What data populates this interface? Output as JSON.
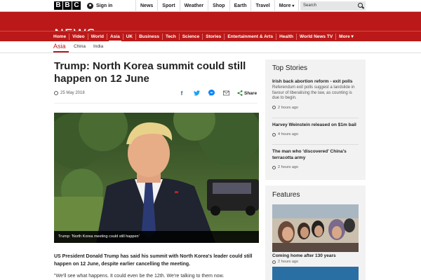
{
  "topbar": {
    "logo_letters": [
      "B",
      "B",
      "C"
    ],
    "signin_label": "Sign in",
    "nav": [
      "News",
      "Sport",
      "Weather",
      "Shop",
      "Earth",
      "Travel",
      "More"
    ],
    "search_placeholder": "Search"
  },
  "header": {
    "title": "NEWS",
    "nav": [
      "Home",
      "Video",
      "World",
      "Asia",
      "UK",
      "Business",
      "Tech",
      "Science",
      "Stories",
      "Entertainment & Arts",
      "Health",
      "World News TV",
      "More"
    ],
    "active": "Asia"
  },
  "subnav": {
    "current": "Asia",
    "items": [
      "China",
      "India"
    ]
  },
  "article": {
    "headline": "Trump: North Korea summit could still happen on 12 June",
    "date": "25 May 2018",
    "share_label": "Share",
    "share_icons": [
      "facebook-icon",
      "twitter-icon",
      "messenger-icon",
      "email-icon",
      "share-icon"
    ],
    "image_caption": "Trump: 'North Korea meeting could still happen'",
    "lede": "US President Donald Trump has said his summit with North Korea's leader could still happen on 12 June, despite earlier cancelling the meeting.",
    "quote": "\"We'll see what happens. It could even be the 12th. We're talking to them now."
  },
  "sidebar": {
    "top_stories_title": "Top Stories",
    "stories": [
      {
        "title": "Irish back abortion reform - exit polls",
        "summary": "Referendum exit polls suggest a landslide in favour of liberalising the law, as counting is due to begin.",
        "time": "2 hours ago"
      },
      {
        "title": "Harvey Weinstein released on $1m bail",
        "summary": "",
        "time": "4 hours ago"
      },
      {
        "title": "The man who 'discovered' China's terracotta army",
        "summary": "",
        "time": "2 hours ago"
      }
    ],
    "features_title": "Features",
    "feature": {
      "caption": "Coming home after 130 years",
      "time": "2 hours ago"
    }
  },
  "colors": {
    "brand_red": "#bb1919",
    "sidebar_bg": "#f2f2f2"
  }
}
